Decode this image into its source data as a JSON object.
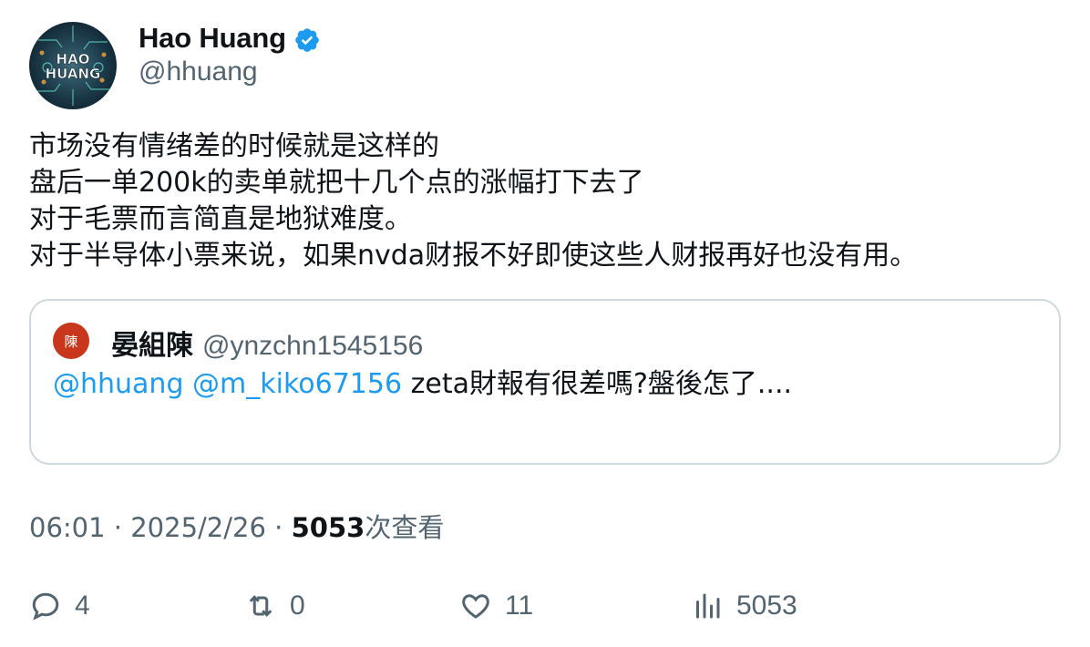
{
  "author": {
    "name": "Hao Huang",
    "handle": "@hhuang",
    "verified": true,
    "avatar_text_line1": "HAO",
    "avatar_text_line2": "HUANG"
  },
  "tweet": {
    "lines": [
      "市场没有情绪差的时候就是这样的",
      "盘后一单200k的卖单就把十几个点的涨幅打下去了",
      "对于毛票而言简直是地狱难度。",
      "对于半导体小票来说，如果nvda财报不好即使这些人财报再好也没有用。"
    ]
  },
  "quote": {
    "avatar_char": "陳",
    "name": "晏組陳",
    "handle": "@ynzchn1545156",
    "mention1": "@hhuang",
    "mention2": "@m_kiko67156",
    "text": "zeta財報有很差嗎?盤後怎了...."
  },
  "meta": {
    "time": "06:01",
    "separator": "·",
    "date": "2025/2/26",
    "views_count": "5053",
    "views_label": "次查看"
  },
  "actions": {
    "replies": "4",
    "retweets": "0",
    "likes": "11",
    "views": "5053"
  },
  "colors": {
    "accent": "#1d9bf0",
    "muted": "#536471",
    "border": "#cfd9de",
    "quote_avatar": "#c8361b"
  }
}
